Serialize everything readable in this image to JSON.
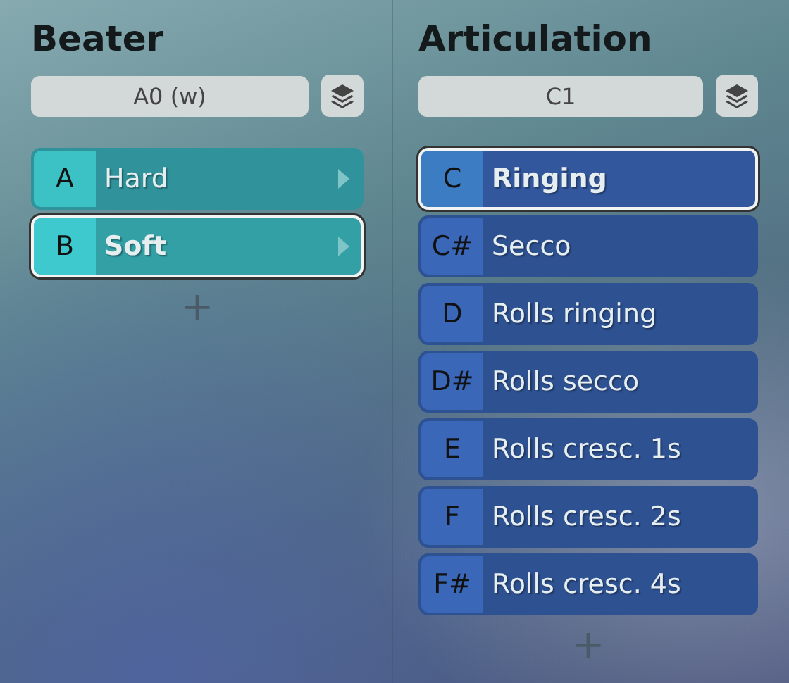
{
  "panels": [
    {
      "title": "Beater",
      "field": {
        "value": "A0 (w)"
      },
      "color": "#3cc2c4",
      "arrows": true,
      "items": [
        {
          "key": "A",
          "label": "Hard",
          "selected": false
        },
        {
          "key": "B",
          "label": "Soft",
          "selected": true
        }
      ],
      "add": "+"
    },
    {
      "title": "Articulation",
      "field": {
        "value": "C1"
      },
      "color": "#3a67b8",
      "arrows": false,
      "items": [
        {
          "key": "C",
          "label": "Ringing",
          "selected": true
        },
        {
          "key": "C#",
          "label": "Secco",
          "selected": false
        },
        {
          "key": "D",
          "label": "Rolls ringing",
          "selected": false
        },
        {
          "key": "D#",
          "label": "Rolls secco",
          "selected": false
        },
        {
          "key": "E",
          "label": "Rolls cresc. 1s",
          "selected": false
        },
        {
          "key": "F",
          "label": "Rolls cresc. 2s",
          "selected": false
        },
        {
          "key": "F#",
          "label": "Rolls cresc. 4s",
          "selected": false
        }
      ],
      "add": "+"
    }
  ]
}
